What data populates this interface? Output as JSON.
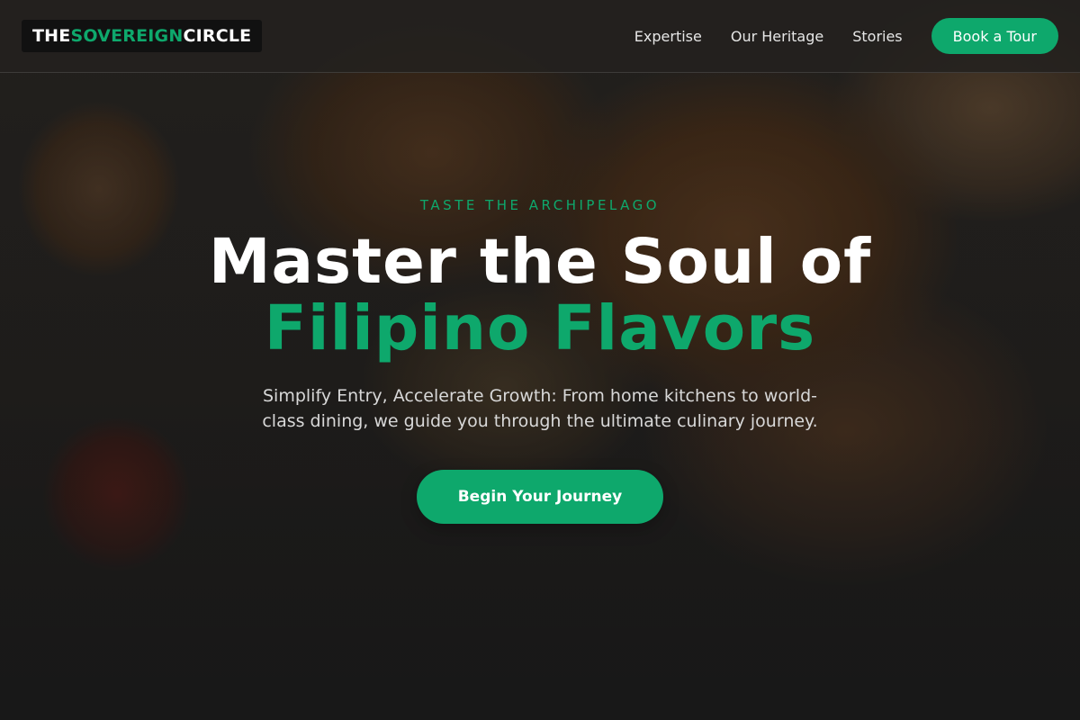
{
  "header": {
    "logo_main": "THE ",
    "logo_accent": "SOVEREIGN",
    "logo_tail": " CIRCLE",
    "nav_items": [
      {
        "label": "Expertise"
      },
      {
        "label": "Our Heritage"
      },
      {
        "label": "Stories"
      }
    ],
    "cta_label": "Book a Tour"
  },
  "hero": {
    "eyebrow": "TASTE THE ARCHIPELAGO",
    "headline_line1": "Master the Soul of",
    "headline_line2": "Filipino Flavors",
    "subtitle": "Simplify Entry, Accelerate Growth: From home kitchens to world-class dining, we guide you through the ultimate culinary journey.",
    "button_label": "Begin Your Journey",
    "background_image": "grilled-food-platter"
  },
  "colors": {
    "accent": "#0ea86c",
    "header_bg": "#23211f",
    "text_light": "#ffffff"
  }
}
